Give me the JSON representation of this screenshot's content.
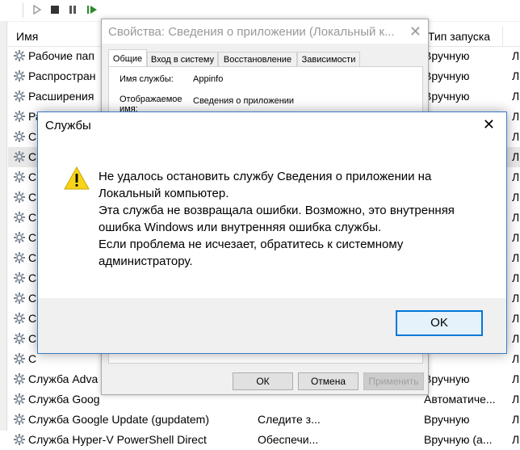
{
  "services": {
    "columns": {
      "name": "Имя",
      "startup": "Тип запуска"
    },
    "rows": [
      {
        "name": "Рабочие пап",
        "description": "",
        "startup": "Вручную",
        "logon": "Л"
      },
      {
        "name": "Распростран",
        "description": "",
        "startup": "Вручную",
        "logon": "Л"
      },
      {
        "name": "Расширения",
        "description": "",
        "startup": "Вручную",
        "logon": "Л"
      },
      {
        "name": "Ра",
        "description": "",
        "startup": "",
        "logon": "Л"
      },
      {
        "name": "С",
        "description": "",
        "startup": "",
        "logon": "Л"
      },
      {
        "name": "С",
        "description": "",
        "startup": "",
        "logon": "Л"
      },
      {
        "name": "С",
        "description": "",
        "startup": "",
        "logon": "Л"
      },
      {
        "name": "С",
        "description": "",
        "startup": "",
        "logon": "Л"
      },
      {
        "name": "С",
        "description": "",
        "startup": "",
        "logon": "Л"
      },
      {
        "name": "С",
        "description": "",
        "startup": "",
        "logon": "Л"
      },
      {
        "name": "С",
        "description": "",
        "startup": "",
        "logon": "Л"
      },
      {
        "name": "С",
        "description": "",
        "startup": "",
        "logon": "Л"
      },
      {
        "name": "С",
        "description": "",
        "startup": "",
        "logon": "Л"
      },
      {
        "name": "С",
        "description": "",
        "startup": "",
        "logon": "Л"
      },
      {
        "name": "С",
        "description": "",
        "startup": "",
        "logon": "Л"
      },
      {
        "name": "С",
        "description": "",
        "startup": "",
        "logon": "Л"
      },
      {
        "name": "Служба Adva",
        "description": "",
        "startup": "Вручную",
        "logon": "Л"
      },
      {
        "name": "Служба Goog",
        "description": "",
        "startup": "Автоматиче...",
        "logon": "Л"
      },
      {
        "name": "Служба Google Update (gupdatem)",
        "description": "Следите з...",
        "startup": "Вручную",
        "logon": "Л"
      },
      {
        "name": "Служба Hyper-V PowerShell Direct",
        "description": "Обеспечи...",
        "startup": "Вручную (а...",
        "logon": "Л"
      }
    ]
  },
  "properties": {
    "title": "Свойства: Сведения о приложении (Локальный к...",
    "tabs": [
      "Общие",
      "Вход в систему",
      "Восстановление",
      "Зависимости"
    ],
    "service_name_label": "Имя службы:",
    "service_name_value": "Appinfo",
    "display_name_label": "Отображаемое имя:",
    "display_name_value": "Сведения о приложении",
    "ok_label": "ОК",
    "cancel_label": "Отмена",
    "apply_label": "Применить"
  },
  "error_dialog": {
    "title": "Службы",
    "lines": [
      "Не удалось остановить службу Сведения о приложении на",
      "Локальный компьютер.",
      "Эта служба не возвращала ошибки. Возможно, это внутренняя",
      "ошибка Windows или внутренняя ошибка службы.",
      "Если проблема не исчезает, обратитесь к системному",
      "администратору."
    ],
    "ok_label": "OK",
    "icon": "warning-icon"
  },
  "toolbar": {
    "icons": [
      "play-icon",
      "stop-icon",
      "pause-icon",
      "resume-icon"
    ]
  },
  "colors": {
    "accent": "#0078d7",
    "warning": "#f8d418",
    "play": "#2c8a2c"
  }
}
